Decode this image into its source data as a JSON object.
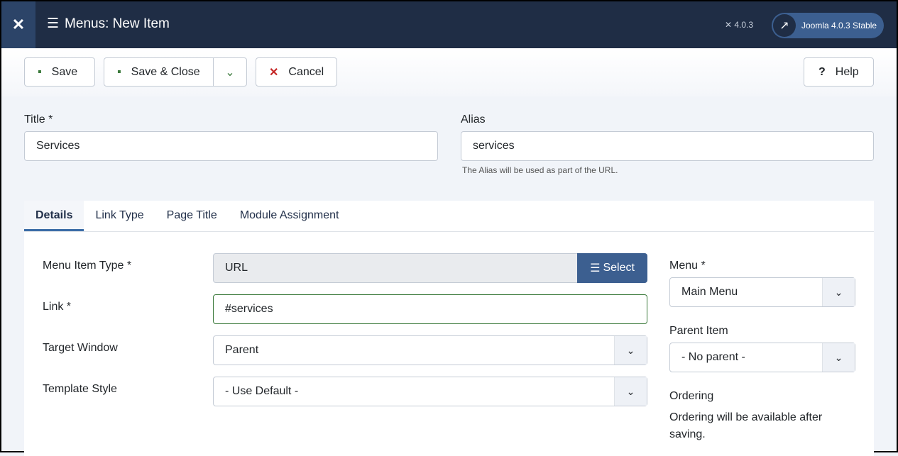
{
  "header": {
    "title": "Menus: New Item",
    "version": "4.0.3",
    "site_button": "Joomla 4.0.3 Stable"
  },
  "toolbar": {
    "save": "Save",
    "save_close": "Save & Close",
    "cancel": "Cancel",
    "help": "Help"
  },
  "form": {
    "title_label": "Title *",
    "title_value": "Services",
    "alias_label": "Alias",
    "alias_value": "services",
    "alias_help": "The Alias will be used as part of the URL."
  },
  "tabs": [
    "Details",
    "Link Type",
    "Page Title",
    "Module Assignment"
  ],
  "details": {
    "type_label": "Menu Item Type *",
    "type_value": "URL",
    "select_button": "Select",
    "link_label": "Link *",
    "link_value": "#services",
    "target_label": "Target Window",
    "target_value": "Parent",
    "style_label": "Template Style",
    "style_value": "- Use Default -"
  },
  "side": {
    "menu_label": "Menu *",
    "menu_value": "Main Menu",
    "parent_label": "Parent Item",
    "parent_value": "- No parent -",
    "ordering_label": "Ordering",
    "ordering_text": "Ordering will be available after saving."
  },
  "colors": {
    "header": "#1f2d45",
    "accent": "#3c5f90"
  }
}
